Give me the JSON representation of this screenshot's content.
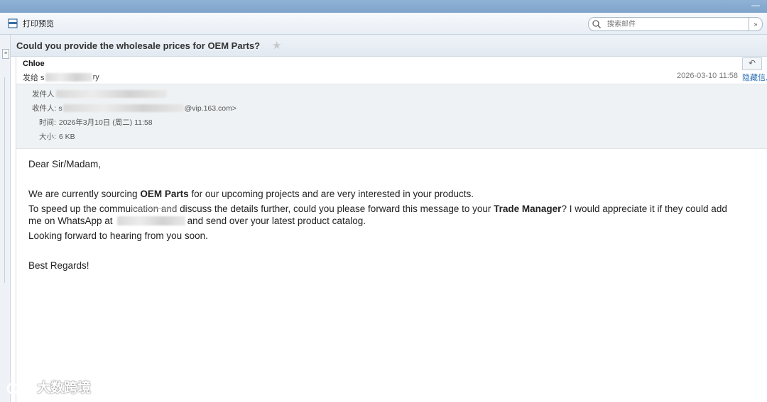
{
  "toolbar": {
    "print_preview_label": "打印预览",
    "search_placeholder": "搜索邮件",
    "search_dropdown": "»"
  },
  "subject": "Could you provide the wholesale prices for OEM Parts?",
  "header": {
    "from_name": "Chloe",
    "to_prefix": "发给 s",
    "to_suffix": "ry",
    "date": "2026-03-10 11:58",
    "hide_info_label": "隐藏信息"
  },
  "details": {
    "sender_label": "发件人",
    "recipient_label": "收件人: s",
    "recipient_suffix": "@vip.163.com>",
    "time_label": "时间:",
    "time_value": "2026年3月10日 (周二) 11:58",
    "size_label": "大小:",
    "size_value": "6 KB"
  },
  "body": {
    "greeting": "Dear Sir/Madam,",
    "p1_a": "We are currently sourcing ",
    "p1_b": "OEM Parts",
    "p1_c": " for our upcoming projects and are very interested in your products.",
    "p2_a": "To speed up the commu",
    "p2_b": "ication and",
    "p2_c": " discuss the details further, could you please forward this message to your ",
    "p2_d": "Trade Manager",
    "p2_e": "? I would appreciate it if they could add",
    "p3_a": "me on WhatsApp at ",
    "p3_b": "and send over your latest product catalog.",
    "p4": "Looking forward to hearing from you soon.",
    "closing": "Best Regards!"
  },
  "watermark": {
    "text": "大数跨境"
  },
  "colors": {
    "titlebar": "#8fb2d6",
    "link": "#2a6db5",
    "detail_bg": "#eff2f4"
  }
}
